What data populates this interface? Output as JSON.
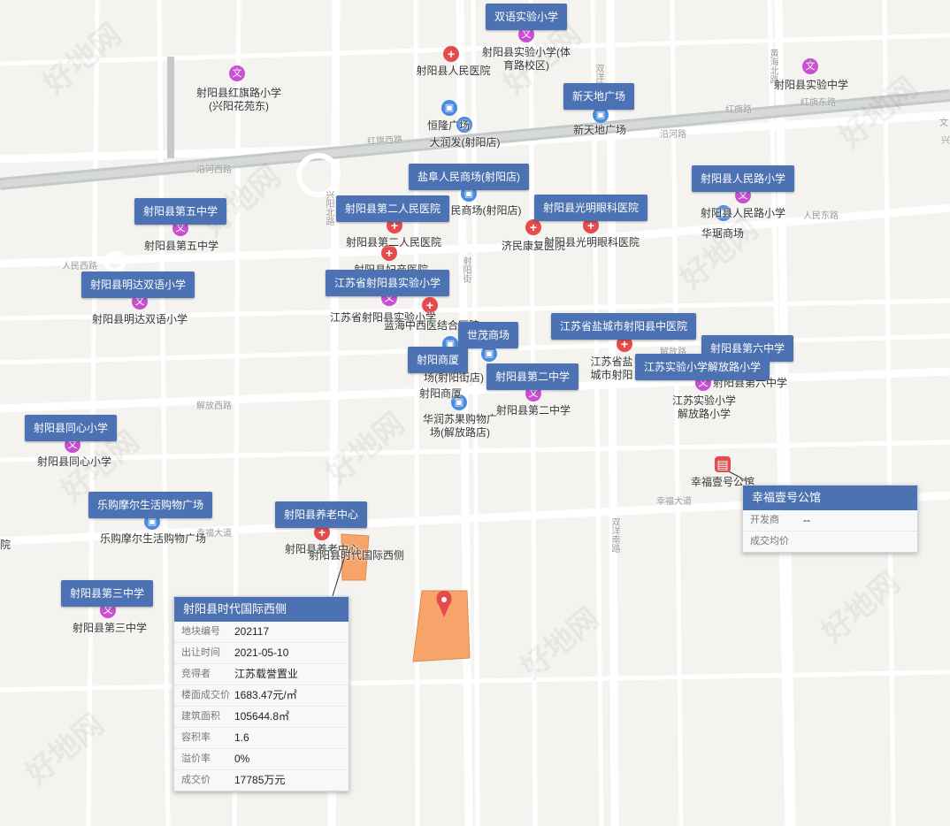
{
  "colors": {
    "tag_bg": "#4d72b3",
    "parcel": "#f7a46a",
    "edu_icon": "#c94fd1",
    "hospital_icon": "#e54b4b",
    "shop_icon": "#4a8be0",
    "pin": "#e54b4b"
  },
  "tags": {
    "t1": "双语实验小学",
    "t2": "新天地广场",
    "t3": "盐阜人民商场(射阳店)",
    "t4": "射阳县人民路小学",
    "t5": "射阳县第五中学",
    "t6": "射阳县第二人民医院",
    "t7": "射阳县光明眼科医院",
    "t8": "射阳县明达双语小学",
    "t9": "江苏省射阳县实验小学",
    "t10": "世茂商场",
    "t11": "江苏省盐城市射阳县中医院",
    "t12": "射阳县第六中学",
    "t13": "射阳商厦",
    "t14": "射阳县第二中学",
    "t15": "江苏实验小学解放路小学",
    "t16": "射阳县同心小学",
    "t17": "乐购摩尔生活购物广场",
    "t18": "射阳县养老中心",
    "t19": "射阳县第三中学"
  },
  "labels": {
    "l1": "射阳县实验小学(体育路校区)",
    "l2": "射阳县人民医院",
    "l3": "射阳县红旗路小学(兴阳花苑东)",
    "l4": "射阳县实验中学",
    "l5": "恒隆广场",
    "l6": "大润发(射阳店)",
    "l7": "新天地广场",
    "l8": "民商场(射阳店)",
    "l9": "射阳县人民路小学",
    "l10": "华琚商场",
    "l11": "射阳县第五中学",
    "l12": "射阳县第二人民医院",
    "l13": "济民康复医院",
    "l14": "射阳县光明眼科医院",
    "l15": "射阳县妇产医院",
    "l16": "射阳县明达双语小学",
    "l17": "江苏省射阳县实验小学",
    "l18": "蓝海中西医结合医院",
    "l19": "射阳县第二中学",
    "l20": "射阳商厦",
    "l21": "华润苏果购物广场(解放路店)",
    "l22": "江苏实验小学解放路小学",
    "l23": "射阳县第六中学",
    "l24": "江苏省盐城市射阳县中医院",
    "l25": "射阳县同心小学",
    "l26": "幸福壹号公馆",
    "l27": "乐购摩尔生活购物广场",
    "l28": "射阳县养老中心",
    "l29": "射阳县时代国际西侧",
    "l30": "射阳县第三中学",
    "l31": "院",
    "l32": "场(射阳街店)"
  },
  "streets": {
    "s1": "红旗西路",
    "s2": "红旗路",
    "s3": "红旗东路",
    "s4": "沿河西路",
    "s5": "沿河路",
    "s6": "人民西路",
    "s7": "人民东路",
    "s8": "解放西路",
    "s9": "解放路",
    "s10": "幸福大道",
    "s11": "幸福大道",
    "s12": "射阳街",
    "s13": "黄海北路",
    "s14": "兴阳北路",
    "s15": "双洋路",
    "s16": "双洋南路",
    "s17": "文",
    "s18": "兴"
  },
  "watermark": "好地网",
  "card_land": {
    "title": "射阳县时代国际西侧",
    "rows": [
      {
        "k": "地块编号",
        "v": "202117"
      },
      {
        "k": "出让时间",
        "v": "2021-05-10"
      },
      {
        "k": "竞得者",
        "v": "江苏载誉置业"
      },
      {
        "k": "楼面成交价",
        "v": "1683.47元/㎡"
      },
      {
        "k": "建筑面积",
        "v": "105644.8㎡"
      },
      {
        "k": "容积率",
        "v": "1.6"
      },
      {
        "k": "溢价率",
        "v": "0%"
      },
      {
        "k": "成交价",
        "v": "17785万元"
      }
    ]
  },
  "card_estate": {
    "title": "幸福壹号公馆",
    "rows": [
      {
        "k": "开发商",
        "v": "--"
      },
      {
        "k": "成交均价",
        "v": ""
      }
    ]
  }
}
